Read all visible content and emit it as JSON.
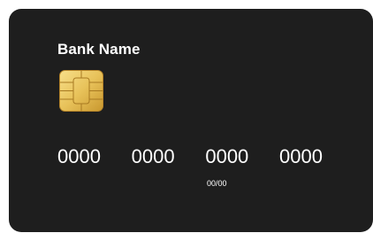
{
  "card": {
    "bank_name": "Bank Name",
    "number_groups": [
      "0000",
      "0000",
      "0000",
      "0000"
    ],
    "expiry": "00/00",
    "colors": {
      "card_background": "#1e1e1e",
      "text": "#ffffff",
      "chip_gold": "#e8c25a"
    },
    "icons": {
      "chip": "emv-chip-icon"
    }
  }
}
